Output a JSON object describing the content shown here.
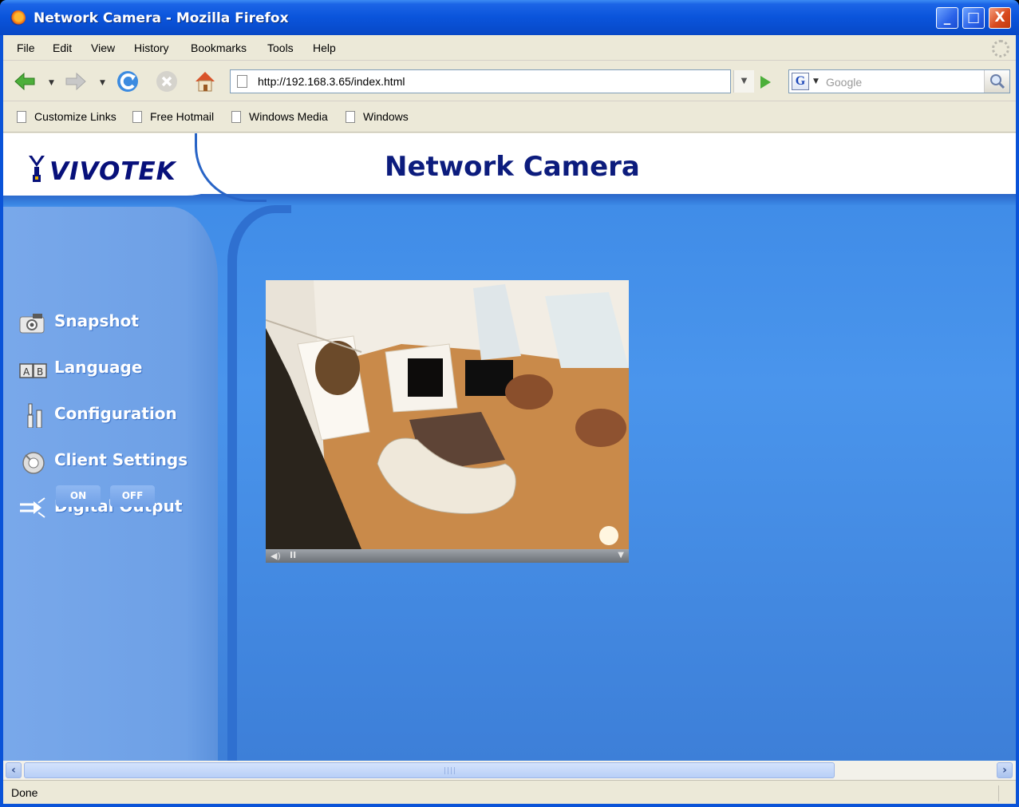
{
  "window": {
    "title": "Network Camera - Mozilla Firefox",
    "controls": {
      "minimize": "_",
      "maximize": "□",
      "close": "X"
    }
  },
  "menubar": {
    "items": [
      "File",
      "Edit",
      "View",
      "History",
      "Bookmarks",
      "Tools",
      "Help"
    ]
  },
  "navbar": {
    "url": "http://192.168.3.65/index.html",
    "search_placeholder": "Google",
    "search_engine_icon": "G"
  },
  "bookmarks": {
    "items": [
      "Customize Links",
      "Free Hotmail",
      "Windows Media",
      "Windows"
    ]
  },
  "page": {
    "logo_text": "VIVOTEK",
    "site_title": "Network Camera",
    "sidebar": [
      {
        "label": "Snapshot",
        "icon": "camera-icon"
      },
      {
        "label": "Language",
        "icon": "language-icon"
      },
      {
        "label": "Configuration",
        "icon": "wrench-icon"
      },
      {
        "label": "Client Settings",
        "icon": "client-settings-icon"
      },
      {
        "label": "Digital Output",
        "icon": "digital-output-icon"
      }
    ],
    "digital_output": {
      "on_label": "ON",
      "off_label": "OFF"
    },
    "player": {
      "sound_icon": "speaker-icon",
      "pause_icon": "pause-icon",
      "menu_icon": "dropdown-icon"
    }
  },
  "statusbar": {
    "text": "Done"
  },
  "colors": {
    "titlebar": "#0a54db",
    "page_background": "#4a95ec",
    "sidebar": "#6da0e6",
    "site_title": "#0c1c7d"
  }
}
